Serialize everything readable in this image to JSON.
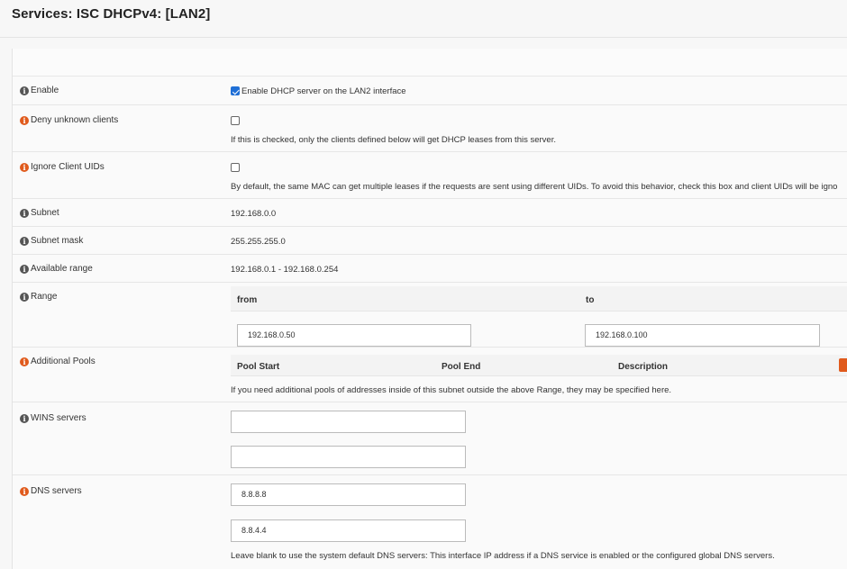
{
  "page": {
    "title": "Services: ISC DHCPv4: [LAN2]"
  },
  "form": {
    "enable": {
      "label": "Enable",
      "checked": true,
      "checkbox_label": "Enable DHCP server on the LAN2 interface"
    },
    "deny_unknown": {
      "label": "Deny unknown clients",
      "checked": false,
      "help": "If this is checked, only the clients defined below will get DHCP leases from this server."
    },
    "ignore_uids": {
      "label": "Ignore Client UIDs",
      "checked": false,
      "help": "By default, the same MAC can get multiple leases if the requests are sent using different UIDs. To avoid this behavior, check this box and client UIDs will be igno"
    },
    "subnet": {
      "label": "Subnet",
      "value": "192.168.0.0"
    },
    "subnet_mask": {
      "label": "Subnet mask",
      "value": "255.255.255.0"
    },
    "available_range": {
      "label": "Available range",
      "value": "192.168.0.1 - 192.168.0.254"
    },
    "range": {
      "label": "Range",
      "from_label": "from",
      "to_label": "to",
      "from_value": "192.168.0.50",
      "to_value": "192.168.0.100"
    },
    "additional_pools": {
      "label": "Additional Pools",
      "columns": [
        "Pool Start",
        "Pool End",
        "Description"
      ],
      "help": "If you need additional pools of addresses inside of this subnet outside the above Range, they may be specified here."
    },
    "wins": {
      "label": "WINS servers",
      "values": [
        "",
        ""
      ]
    },
    "dns": {
      "label": "DNS servers",
      "values": [
        "8.8.8.8",
        "8.8.4.4"
      ],
      "help": "Leave blank to use the system default DNS servers: This interface IP address if a DNS service is enabled or the configured global DNS servers."
    }
  },
  "colors": {
    "accent": "#1f6fd6",
    "warning_icon": "#e05a1c",
    "info_icon": "#555555"
  }
}
